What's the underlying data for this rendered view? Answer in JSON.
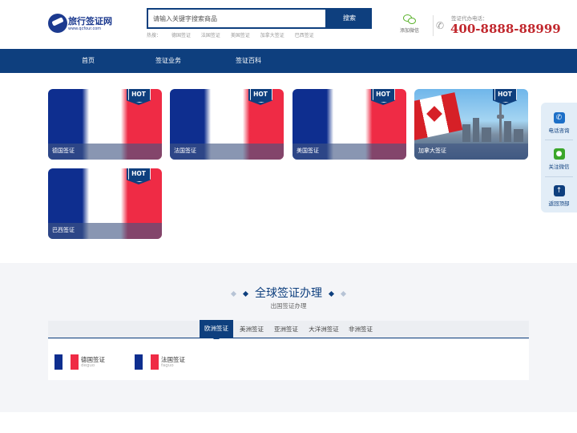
{
  "header": {
    "logo": {
      "name": "旅行签证网",
      "url": "www.qcfour.com"
    },
    "search": {
      "placeholder": "请输入关键字搜索商品",
      "button": "搜索"
    },
    "hot": {
      "label": "热搜：",
      "items": [
        "德国签证",
        "法国签证",
        "美国签证",
        "加拿大签证",
        "巴西签证"
      ]
    },
    "wechat_label": "添加微信",
    "phone": {
      "caption": "签证代办电话：",
      "number": "400-8888-88999"
    }
  },
  "nav": {
    "items": [
      "首页",
      "签证业务",
      "签证百科"
    ]
  },
  "cards": [
    {
      "label": "德国签证",
      "badge": "HOT",
      "image": "flag"
    },
    {
      "label": "法国签证",
      "badge": "HOT",
      "image": "flag"
    },
    {
      "label": "美国签证",
      "badge": "HOT",
      "image": "flag"
    },
    {
      "label": "加拿大签证",
      "badge": "HOT",
      "image": "photo"
    },
    {
      "label": "巴西签证",
      "badge": "HOT",
      "image": "flag"
    }
  ],
  "section": {
    "title": "全球签证办理",
    "subtitle": "出国签证办理",
    "tabs": [
      "欧洲签证",
      "美洲签证",
      "亚洲签证",
      "大洋洲签证",
      "非洲签证"
    ],
    "active_tab": 0,
    "countries": [
      {
        "name": "德国签证",
        "pinyin": "deguo"
      },
      {
        "name": "法国签证",
        "pinyin": "faguo"
      }
    ]
  },
  "side": {
    "items": [
      "电话咨询",
      "关注微信",
      "返回顶部"
    ]
  },
  "colors": {
    "primary": "#0e3f7e",
    "phone": "#c1272d",
    "wechat": "#5ab22b",
    "section_bg": "#f4f5f8"
  }
}
